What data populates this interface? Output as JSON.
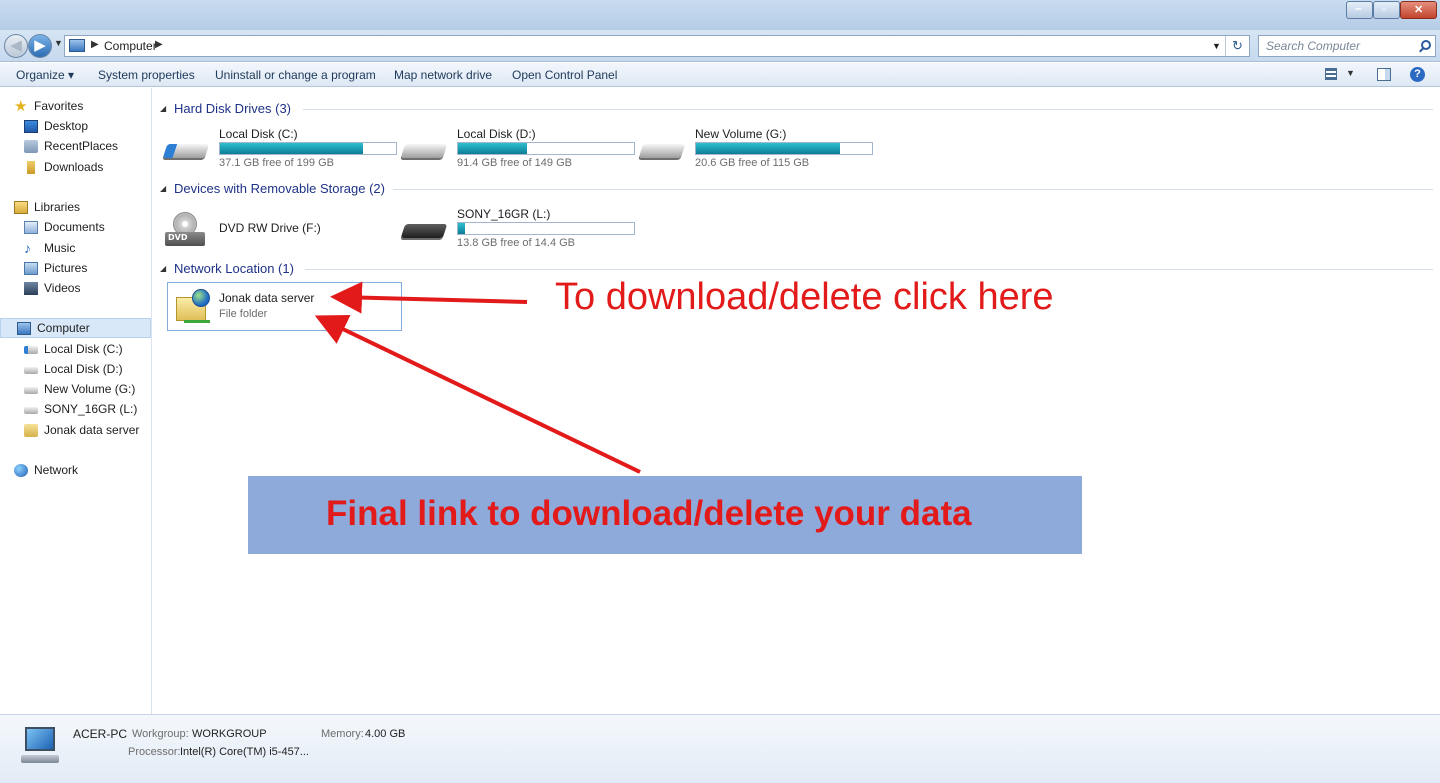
{
  "window": {
    "controls": {
      "minimize": "–",
      "maximize": "▫",
      "close": "✕"
    }
  },
  "address": {
    "path": "Computer",
    "search_placeholder": "Search Computer"
  },
  "toolbar": {
    "organize": "Organize ▾",
    "system_properties": "System properties",
    "uninstall": "Uninstall or change a program",
    "map_drive": "Map network drive",
    "control_panel": "Open Control Panel"
  },
  "sidebar": {
    "favorites": "Favorites",
    "desktop": "Desktop",
    "recent_places": "RecentPlaces",
    "downloads": "Downloads",
    "libraries": "Libraries",
    "documents": "Documents",
    "music": "Music",
    "pictures": "Pictures",
    "videos": "Videos",
    "computer": "Computer",
    "local_c": "Local Disk (C:)",
    "local_d": "Local Disk (D:)",
    "new_volume": "New Volume (G:)",
    "sony": "SONY_16GR (L:)",
    "jonak": "Jonak data server",
    "network": "Network"
  },
  "groups": {
    "hard_disks": "Hard Disk Drives (3)",
    "removable": "Devices with Removable Storage (2)",
    "network": "Network Location (1)"
  },
  "drives": [
    {
      "name": "Local Disk (C:)",
      "free": "37.1 GB free of 199 GB",
      "used_fraction": 0.81
    },
    {
      "name": "Local Disk (D:)",
      "free": "91.4 GB free of 149 GB",
      "used_fraction": 0.39
    },
    {
      "name": "New Volume (G:)",
      "free": "20.6 GB free of 115 GB",
      "used_fraction": 0.82
    }
  ],
  "removable": {
    "dvd_name": "DVD RW Drive (F:)",
    "dvd_label": "DVD",
    "sony_name": "SONY_16GR (L:)",
    "sony_free": "13.8 GB free of 14.4 GB",
    "sony_used_fraction": 0.04
  },
  "network_item": {
    "name": "Jonak data server",
    "type": "File folder"
  },
  "annotations": {
    "click_here": "To download/delete click here",
    "final_link": "Final link to download/delete your data",
    "color": "#e31a1a"
  },
  "details": {
    "pc_name": "ACER-PC",
    "workgroup_label": "Workgroup:",
    "workgroup": "WORKGROUP",
    "memory_label": "Memory:",
    "memory": "4.00 GB",
    "processor_label": "Processor:",
    "processor": "Intel(R) Core(TM) i5-457..."
  }
}
